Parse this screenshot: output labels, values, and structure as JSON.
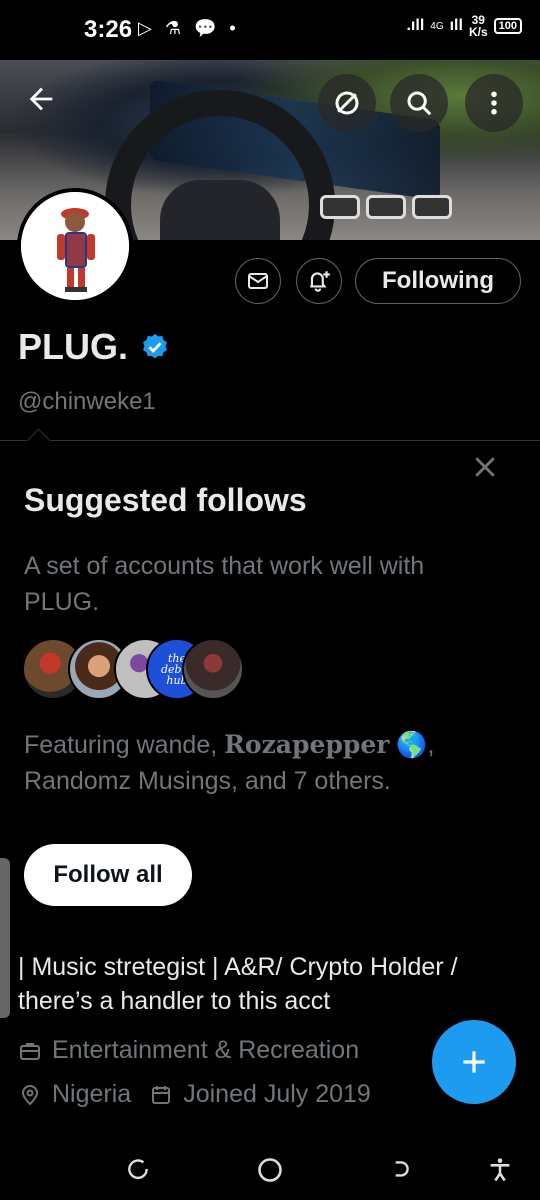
{
  "status_bar": {
    "time": "3:26",
    "notif_icons": "▷ ⚗ 💬 •",
    "network_label": "4G",
    "speed_value": "39",
    "speed_unit": "K/s",
    "battery": "100"
  },
  "header": {
    "back_icon": "arrow-left-icon",
    "actions": [
      "cancel-circle-icon",
      "search-icon",
      "more-vertical-icon"
    ]
  },
  "profile": {
    "name": "PLUG.",
    "handle": "@chinweke1",
    "verified": true,
    "following_label": "Following",
    "message_icon": "mail-icon",
    "notify_icon": "bell-plus-icon"
  },
  "suggested": {
    "title": "Suggested follows",
    "description": "A set of accounts that work well with PLUG.",
    "featuring_prefix": "Featuring wande, ",
    "featuring_highlight": "Rozapepper",
    "featuring_emoji": "🌎",
    "featuring_suffix": ", Randomz Musings, and 7 others.",
    "follow_all_label": "Follow all",
    "debut_hub_text": "the debut hub"
  },
  "bio": {
    "text": "| Music stretegist | A&R/ Crypto Holder / there’s a handler to this acct",
    "category": "Entertainment & Recreation",
    "location": "Nigeria",
    "joined": "Joined July 2019"
  },
  "colors": {
    "accent": "#1d9bf0",
    "muted": "#71767b",
    "text": "#e7e9ea",
    "background": "#000000"
  }
}
